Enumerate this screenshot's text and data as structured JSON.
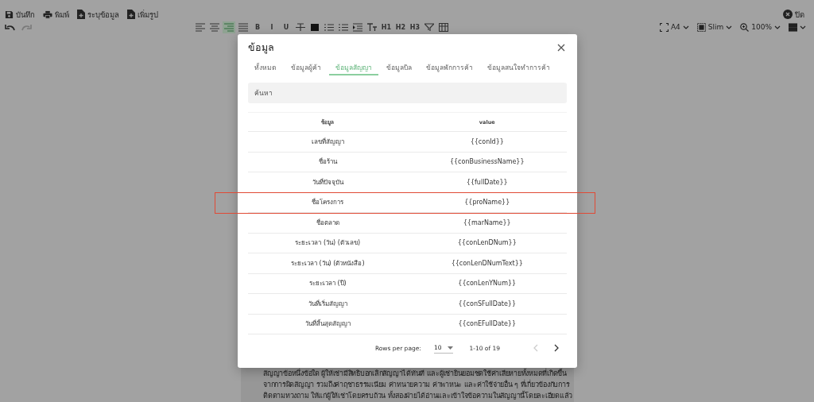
{
  "toolbar": {
    "actions": [
      {
        "kind": "save",
        "label": "บันทึก"
      },
      {
        "kind": "print",
        "label": "พิมพ์"
      },
      {
        "kind": "file-add",
        "label": "ระบุข้อมูล"
      },
      {
        "kind": "file-add",
        "label": "เพิ่มรูป"
      }
    ],
    "close": "ปิด"
  },
  "history": [
    {
      "kind": "undo",
      "disabled": false
    },
    {
      "kind": "redo",
      "disabled": true
    }
  ],
  "format_buttons": [
    {
      "kind": "align-left",
      "selected": false
    },
    {
      "kind": "align-center",
      "selected": false
    },
    {
      "kind": "align-right",
      "selected": true
    },
    {
      "kind": "justify",
      "selected": false
    },
    {
      "kind": "text",
      "label": "B",
      "selected": false
    },
    {
      "kind": "text",
      "label": "I",
      "selected": false
    },
    {
      "kind": "text",
      "label": "U",
      "selected": false
    },
    {
      "kind": "strike",
      "selected": false
    },
    {
      "kind": "color",
      "selected": false
    },
    {
      "kind": "list",
      "selected": false
    },
    {
      "kind": "list",
      "selected": false
    },
    {
      "kind": "indent",
      "selected": false
    },
    {
      "kind": "clear",
      "selected": false
    },
    {
      "kind": "text",
      "label": "H1",
      "selected": false
    },
    {
      "kind": "text",
      "label": "H2",
      "selected": false
    },
    {
      "kind": "text",
      "label": "H3",
      "selected": false
    },
    {
      "kind": "filter",
      "selected": false
    },
    {
      "kind": "table",
      "selected": false
    }
  ],
  "view_controls": [
    {
      "kind": "page-size",
      "label": "A4"
    },
    {
      "kind": "margin",
      "label": "Slim"
    },
    {
      "kind": "zoom",
      "label": "100%"
    },
    {
      "kind": "layout"
    }
  ],
  "dialog": {
    "title": "ข้อมูล",
    "tabs": [
      {
        "label": "ทั้งหมด",
        "selected": false
      },
      {
        "label": "ข้อมูลผู้ค้า",
        "selected": false
      },
      {
        "label": "ข้อมูลสัญญา",
        "selected": true
      },
      {
        "label": "ข้อมูลบิล",
        "selected": false
      },
      {
        "label": "ข้อมูลพักการค้า",
        "selected": false
      },
      {
        "label": "ข้อมูลสนใจทำการค้า",
        "selected": false
      }
    ],
    "search": {
      "placeholder": "ค้นหา"
    },
    "table": {
      "columns": [
        "ข้อมูล",
        "value"
      ],
      "rows": [
        {
          "field": "เลขที่สัญญา",
          "value": "{{conId}}",
          "highlighted": false
        },
        {
          "field": "ชื่อร้าน",
          "value": "{{conBusinessName}}",
          "highlighted": false
        },
        {
          "field": "วันที่ปัจจุบัน",
          "value": "{{fullDate}}",
          "highlighted": false
        },
        {
          "field": "ชื่อโครงการ",
          "value": "{{proName}}",
          "highlighted": true
        },
        {
          "field": "ชื่อตลาด",
          "value": "{{marName}}",
          "highlighted": false
        },
        {
          "field": "ระยะเวลา (วัน) (ตัวเลข)",
          "value": "{{conLenDNum}}",
          "highlighted": false
        },
        {
          "field": "ระยะเวลา (วัน) (ตัวหนังสือ)",
          "value": "{{conLenDNumText}}",
          "highlighted": false
        },
        {
          "field": "ระยะเวลา (ปี)",
          "value": "{{conLenYNum}}",
          "highlighted": false
        },
        {
          "field": "วันที่เริ่มสัญญา",
          "value": "{{conSFullDate}}",
          "highlighted": false
        },
        {
          "field": "วันที่สิ้นสุดสัญญา",
          "value": "{{conEFullDate}}",
          "highlighted": false
        }
      ]
    },
    "pagination": {
      "rows_per_page_label": "Rows per page:",
      "rows_per_page": "10",
      "range": "1-10 of 19",
      "prev_disabled": true,
      "next_disabled": false
    }
  },
  "document": {
    "lines": [
      "สัญญาข้อหนึ่งข้อใด ผู้ให้เช่ามีสิทธิบอกเลิกสัญญาได้ทันที และผู้เช่ายินยอมชดใช้ค่าเสียหายทั้งหมดที่เกิดขึ้น",
      "จากการผิดสัญญา รวมถึงค่าฤชาธรรมเนียม ค่าทนายความ ค่าพาหนะ และค่าใช้จ่ายอื่น ๆ ที่เกี่ยวข้องกับการ",
      "ติดตามทวงถาม ให้แก่ผู้ให้เช่าโดยครบถ้วน ทั้งสองฝ่ายได้อ่านและเข้าใจข้อความในสัญญานี้โดยละเอียดแล้ว"
    ]
  }
}
